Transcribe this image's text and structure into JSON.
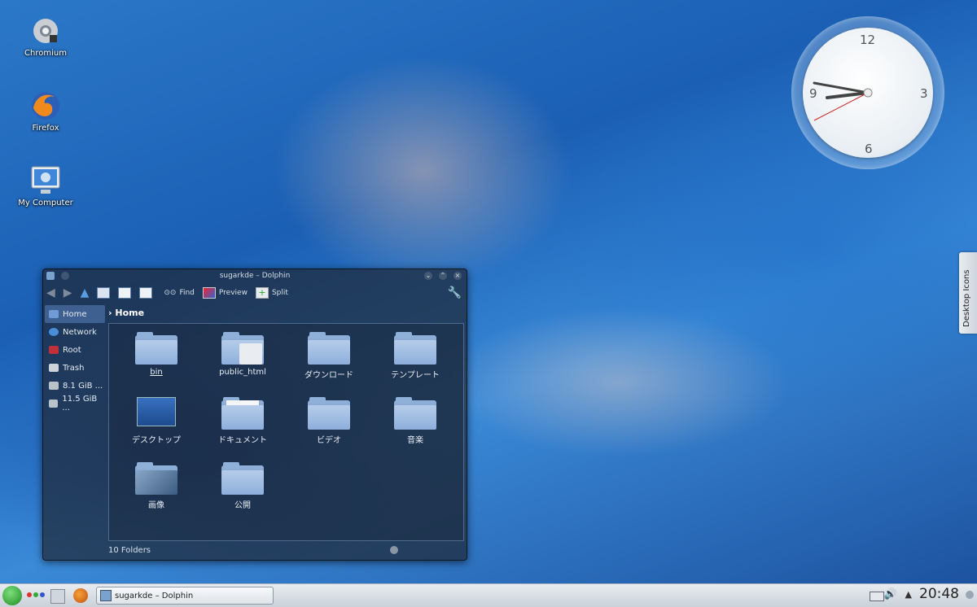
{
  "desktop": {
    "icons": [
      {
        "label": "Chromium"
      },
      {
        "label": "Firefox"
      },
      {
        "label": "My Computer"
      }
    ],
    "side_tab_label": "Desktop Icons",
    "clock_numbers": [
      "12",
      "3",
      "6",
      "9"
    ]
  },
  "dolphin": {
    "title": "sugarkde – Dolphin",
    "toolbar": {
      "find": "Find",
      "preview": "Preview",
      "split": "Split"
    },
    "places": [
      {
        "label": "Home"
      },
      {
        "label": "Network"
      },
      {
        "label": "Root"
      },
      {
        "label": "Trash"
      },
      {
        "label": "8.1 GiB ..."
      },
      {
        "label": "11.5 GiB ..."
      }
    ],
    "breadcrumb": "Home",
    "items": [
      {
        "label": "bin"
      },
      {
        "label": "public_html"
      },
      {
        "label": "ダウンロード"
      },
      {
        "label": "テンプレート"
      },
      {
        "label": "デスクトップ"
      },
      {
        "label": "ドキュメント"
      },
      {
        "label": "ビデオ"
      },
      {
        "label": "音楽"
      },
      {
        "label": "画像"
      },
      {
        "label": "公開"
      }
    ],
    "status": "10 Folders"
  },
  "taskbar": {
    "task_label": "sugarkde – Dolphin",
    "time": "20:48"
  },
  "colors": {
    "water": "#1a5fb4",
    "panel": "#dde3e9",
    "folder": "#8eaedb"
  }
}
